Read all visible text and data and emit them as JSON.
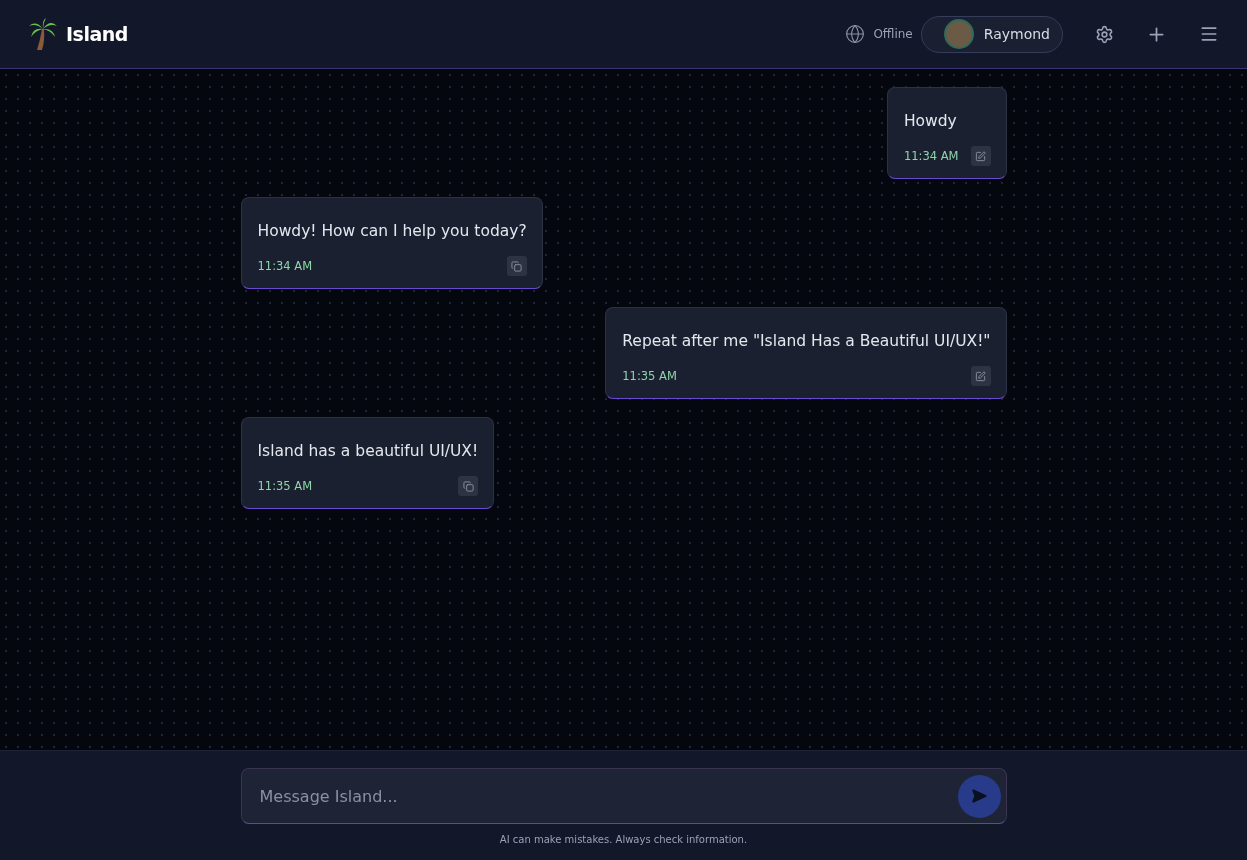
{
  "app": {
    "name": "Island"
  },
  "header": {
    "status": "Offline",
    "user": "Raymond"
  },
  "messages": [
    {
      "kind": "user",
      "text": "Howdy",
      "time": "11:34 AM"
    },
    {
      "kind": "assistant",
      "text": "Howdy! How can I help you today?",
      "time": "11:34 AM"
    },
    {
      "kind": "user",
      "text": "Repeat after me \"Island Has a Beautiful UI/UX!\"",
      "time": "11:35 AM"
    },
    {
      "kind": "assistant",
      "text": "Island has a beautiful UI/UX!",
      "time": "11:35 AM"
    }
  ],
  "composer": {
    "placeholder": "Message Island...",
    "disclaimer": "AI can make mistakes. Always check information."
  }
}
